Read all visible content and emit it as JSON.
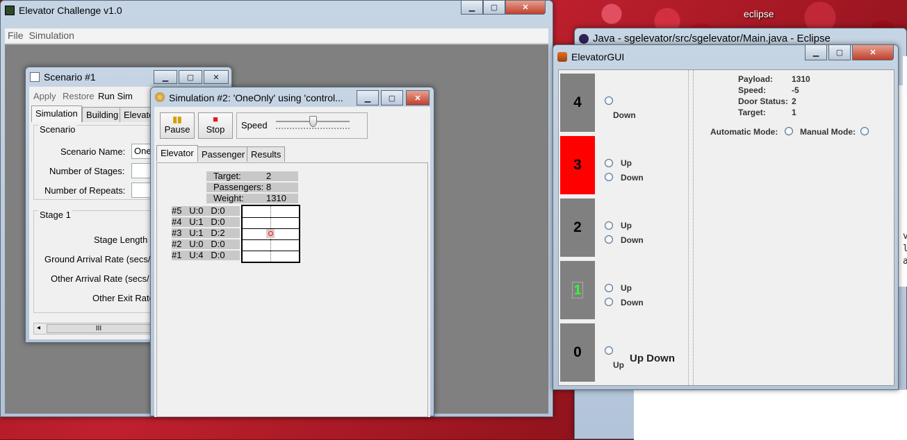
{
  "desktop": {
    "eclipse_label": "eclipse"
  },
  "main_window": {
    "title": "Elevator Challenge v1.0",
    "menu": [
      "File",
      "Simulation"
    ]
  },
  "eclipse_window": {
    "title": "Java - sgelevator/src/sgelevator/Main.java - Eclipse",
    "code_lines": [
      "va",
      "le",
      "at"
    ]
  },
  "scenario_window": {
    "title": "Scenario #1",
    "toolbar": [
      "Apply",
      "Restore",
      "Run Sim"
    ],
    "tabs": [
      "Simulation",
      "Building",
      "Elevato"
    ],
    "scenario_group": "Scenario",
    "fields": [
      {
        "label": "Scenario Name:",
        "value": "One"
      },
      {
        "label": "Number of Stages:",
        "value": ""
      },
      {
        "label": "Number of Repeats:",
        "value": ""
      }
    ],
    "stage_group": "Stage 1",
    "stage_fields": [
      "Stage Length (",
      "Ground Arrival Rate (secs/",
      "Other Arrival Rate (secs/",
      "Other Exit Rate"
    ],
    "scroll_grip": "III"
  },
  "sim_window": {
    "title": "Simulation #2: 'OneOnly' using 'control...",
    "pause": "Pause",
    "stop": "Stop",
    "speed": "Speed",
    "speed_level": 0.5,
    "tabs": [
      "Elevator",
      "Passenger",
      "Results"
    ],
    "info": [
      {
        "label": "Target:",
        "value": "2"
      },
      {
        "label": "Passengers:",
        "value": "8"
      },
      {
        "label": "Weight:",
        "value": "1310"
      }
    ],
    "floors": [
      {
        "label": "#5   U:0   D:0"
      },
      {
        "label": "#4   U:1   D:0"
      },
      {
        "label": "#3   U:1   D:2"
      },
      {
        "label": "#2   U:0   D:0"
      },
      {
        "label": "#1   U:4   D:0"
      }
    ]
  },
  "gui_window": {
    "title": "ElevatorGUI",
    "floors": [
      {
        "number": "4",
        "buttons": [
          "Down"
        ],
        "color": "#808080"
      },
      {
        "number": "3",
        "buttons": [
          "Up",
          "Down"
        ],
        "color": "#ff0000"
      },
      {
        "number": "2",
        "buttons": [
          "Up",
          "Down"
        ],
        "color": "#808080"
      },
      {
        "number": "1",
        "buttons": [
          "Up",
          "Down"
        ],
        "color": "#808080"
      },
      {
        "number": "0",
        "buttons": [
          "Up"
        ],
        "color": "#808080",
        "extra": "Up Down"
      }
    ],
    "status": [
      {
        "key": "Payload:",
        "value": "1310"
      },
      {
        "key": "Speed:",
        "value": "-5"
      },
      {
        "key": "Door Status:",
        "value": "2"
      },
      {
        "key": "Target:",
        "value": "1"
      }
    ],
    "auto_mode": "Automatic Mode:",
    "manual_mode": "Manual Mode:"
  }
}
